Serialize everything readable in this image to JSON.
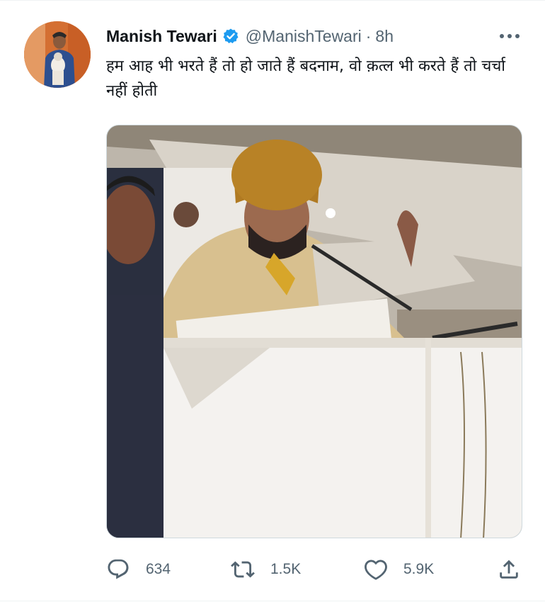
{
  "tweet": {
    "author_name": "Manish Tewari",
    "handle": "@ManishTewari",
    "separator": "·",
    "time": "8h",
    "verified": true,
    "text": "हम आह भी भरते हैं तो हो जाते हैं बदनाम, वो क़त्ल भी करते हैं तो चर्चा नहीं होती"
  },
  "actions": {
    "replies": "634",
    "retweets": "1.5K",
    "likes": "5.9K"
  },
  "icons": {
    "verified": "verified-badge-icon",
    "more": "more-options-icon",
    "reply": "reply-icon",
    "retweet": "retweet-icon",
    "like": "like-heart-icon",
    "share": "share-icon"
  },
  "colors": {
    "text": "#0f1419",
    "secondary": "#536471",
    "verified_blue": "#1d9bf0",
    "divider": "#eff3f4"
  }
}
